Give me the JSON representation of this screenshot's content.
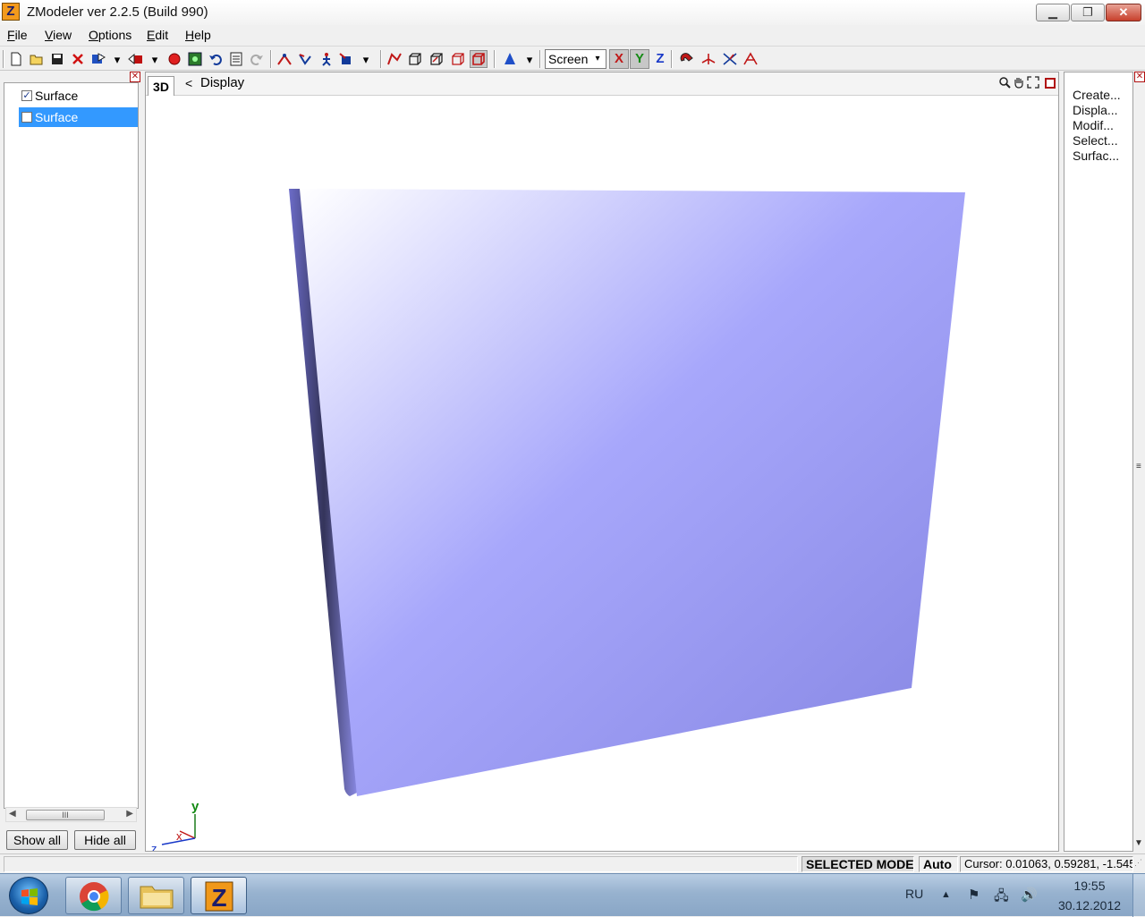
{
  "window": {
    "title": "ZModeler ver 2.2.5 (Build 990)",
    "app_icon_letter": "Z",
    "minimize_glyph": "▁",
    "restore_glyph": "❐",
    "close_glyph": "✕"
  },
  "menu": [
    {
      "key": "F",
      "rest": "ile"
    },
    {
      "key": "V",
      "rest": "iew"
    },
    {
      "key": "O",
      "rest": "ptions"
    },
    {
      "key": "E",
      "rest": "dit"
    },
    {
      "key": "H",
      "rest": "elp"
    }
  ],
  "toolbar": {
    "view_select": "Screen",
    "axis_x": "X",
    "axis_y": "Y",
    "axis_z": "Z",
    "dropdown_glyph": "▾"
  },
  "left_panel": {
    "close_glyph": "✕",
    "items": [
      {
        "label": "Surface",
        "checked": true,
        "check_glyph": "✓"
      },
      {
        "label": "Surface",
        "checked": false,
        "check_glyph": ""
      }
    ],
    "scroll_thumb_glyph": "III",
    "scroll_left_glyph": "◀",
    "scroll_right_glyph": "▶",
    "show_all": "Show all",
    "hide_all": "Hide all"
  },
  "viewport": {
    "mode": "3D",
    "back_glyph": "<",
    "label": "Display",
    "surface_color_light": "#ffffff",
    "surface_color_mid": "#a7a7fb",
    "surface_color_dark": "#8585e2",
    "axes": {
      "x": "x",
      "y": "y",
      "z": "z"
    }
  },
  "right_panel": {
    "items": [
      "Create...",
      "Displa...",
      "Modif...",
      "Select...",
      "Surfac..."
    ],
    "close_glyph": "✕",
    "grip_glyph": "≡",
    "scroll_down_glyph": "▼"
  },
  "status": {
    "mode": "SELECTED MODE",
    "auto": "Auto",
    "cursor": "Cursor: 0.01063, 0.59281, -1.545",
    "grip": "⋰"
  },
  "taskbar": {
    "lang": "RU",
    "tray_up": "▲",
    "flag_glyph": "⚑",
    "network_glyph": "🖧",
    "volume_glyph": "🔊",
    "time": "19:55",
    "date": "30.12.2012",
    "zmodeler_letter": "Z"
  }
}
